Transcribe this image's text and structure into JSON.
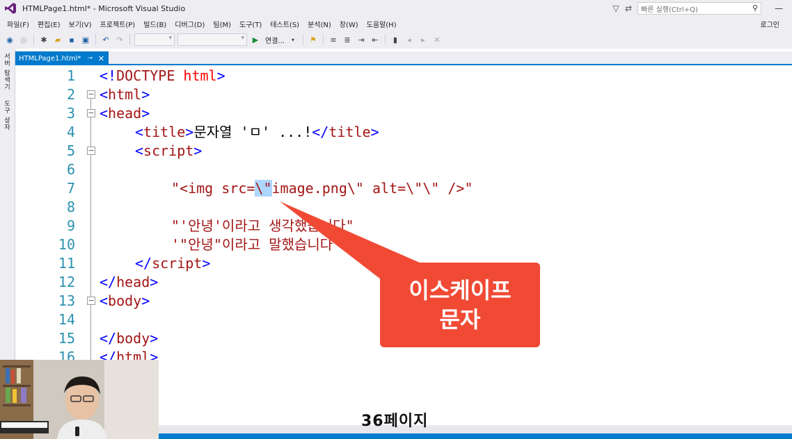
{
  "window": {
    "title": "HTMLPage1.html* - Microsoft Visual Studio",
    "quick_launch_placeholder": "빠른 실행(Ctrl+Q)"
  },
  "menu": {
    "items": [
      "파일(F)",
      "편집(E)",
      "보기(V)",
      "프로젝트(P)",
      "빌드(B)",
      "디버그(D)",
      "팀(M)",
      "도구(T)",
      "테스트(S)",
      "분석(N)",
      "창(W)",
      "도움말(H)"
    ],
    "login": "로그인"
  },
  "toolbar": {
    "run_label": "연결..."
  },
  "side_rail": {
    "items": [
      "서버 탐색기",
      "도구 상자"
    ]
  },
  "editor": {
    "tab_label": "HTMLPage1.html*",
    "line_numbers": [
      "1",
      "2",
      "3",
      "4",
      "5",
      "6",
      "7",
      "8",
      "9",
      "10",
      "11",
      "12",
      "13",
      "14",
      "15",
      "16"
    ],
    "lines": {
      "l1": {
        "open": "<!",
        "kw": "DOCTYPE",
        "attr": " html",
        "close": ">"
      },
      "l2": {
        "open": "<",
        "tag": "html",
        "close": ">"
      },
      "l3": {
        "open": "<",
        "tag": "head",
        "close": ">"
      },
      "l4": {
        "open1": "<",
        "tag1": "title",
        "close1": ">",
        "text": "문자열 'ㅁ' ...!",
        "open2": "</",
        "tag2": "title",
        "close2": ">"
      },
      "l5": {
        "open": "<",
        "tag": "script",
        "close": ">"
      },
      "l7": {
        "a": "\"<img src=",
        "b": "\\\"",
        "c": "image.png\\\" alt=\\\"\\\" />\""
      },
      "l9": "\"'안녕'이라고 생각했습니다\"",
      "l10": "'\"안녕\"이라고 말했습니다'",
      "l11": {
        "open": "</",
        "tag": "script",
        "close": ">"
      },
      "l12": {
        "open": "</",
        "tag": "head",
        "close": ">"
      },
      "l13": {
        "open": "<",
        "tag": "body",
        "close": ">"
      },
      "l15": {
        "open": "</",
        "tag": "body",
        "close": ">"
      },
      "l16": {
        "open": "</",
        "tag": "html",
        "close": ">"
      }
    }
  },
  "callout": {
    "line1": "이스케이프",
    "line2": "문자"
  },
  "caption": "36페이지",
  "colors": {
    "accent": "#007acc",
    "callout": "#f04a35"
  }
}
